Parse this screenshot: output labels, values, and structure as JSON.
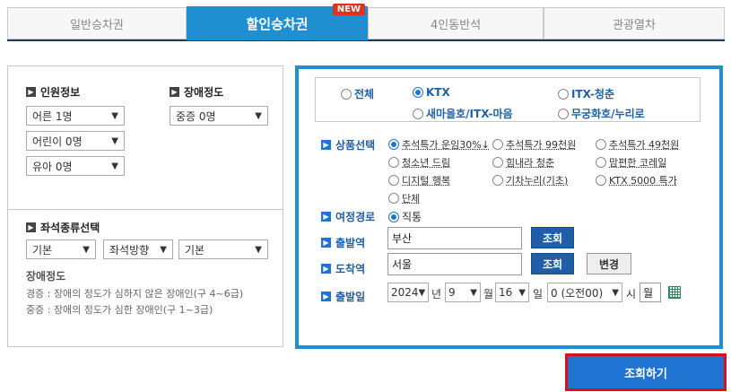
{
  "tabs": [
    {
      "label": "일반승차권"
    },
    {
      "label": "할인승차권",
      "badge": "NEW"
    },
    {
      "label": "4인동반석"
    },
    {
      "label": "관광열차"
    }
  ],
  "passengers": {
    "title": "인원정보",
    "adult": "어른 1명",
    "child": "어린이 0명",
    "infant": "유아 0명"
  },
  "disability": {
    "title": "장애정도",
    "value": "중증 0명"
  },
  "seat": {
    "title": "좌석종류선택",
    "type": "기본",
    "direction": "좌석방향",
    "position": "기본"
  },
  "disability_note": {
    "title": "장애정도",
    "mild": "경증 : 장애의 정도가 심하지 않은 장애인(구 4~6급)",
    "severe": "중증 : 장애의 정도가 심한 장애인(구 1~3급)"
  },
  "train_types": {
    "all": "전체",
    "ktx": "KTX",
    "itx_cheongchun": "ITX-청춘",
    "saemaeul": "새마을호/ITX-마음",
    "mugunghwa": "무궁화호/누리로",
    "selected": "KTX"
  },
  "products": {
    "label": "상품선택",
    "items": [
      "추석특가 운임30%↓",
      "추석특가 99천원",
      "추석특가 49천원",
      "청소년 드림",
      "힘내라 청춘",
      "맘편한 코레일",
      "디지털 행복",
      "기차누리(기초)",
      "KTX 5000 특가",
      "단체"
    ],
    "selected": "추석특가 운임30%↓"
  },
  "route": {
    "label": "여정경로",
    "option": "직통"
  },
  "departure": {
    "label": "출발역",
    "value": "부산",
    "button": "조회"
  },
  "arrival": {
    "label": "도착역",
    "value": "서울",
    "button": "조회",
    "swap": "변경"
  },
  "date": {
    "label": "출발일",
    "year": "2024",
    "year_unit": "년",
    "month": "9",
    "month_unit": "월",
    "day": "16",
    "day_unit": "일",
    "hour": "0 (오전00)",
    "hour_unit": "시",
    "weekday": "월"
  },
  "search_button": "조회하기"
}
